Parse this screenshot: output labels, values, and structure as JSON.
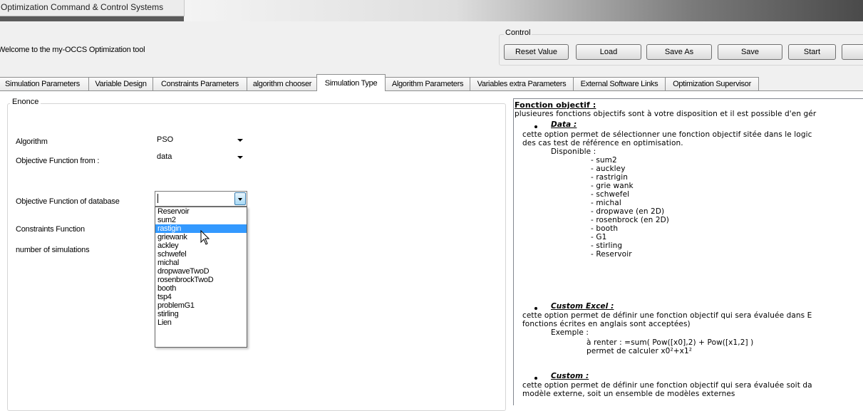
{
  "window": {
    "title": "Optimization Command & Control Systems"
  },
  "header": {
    "welcome": "Welcome to the my-OCCS Optimization tool",
    "control_label": "Control",
    "buttons": [
      "Reset Value",
      "Load",
      "Save As",
      "Save",
      "Start"
    ]
  },
  "tabs": [
    {
      "label": "Simulation Parameters",
      "active": false
    },
    {
      "label": "Variable Design",
      "active": false
    },
    {
      "label": "Constraints Parameters",
      "active": false
    },
    {
      "label": "algorithm chooser",
      "active": false
    },
    {
      "label": "Simulation Type",
      "active": true
    },
    {
      "label": "Algorithm Parameters",
      "active": false
    },
    {
      "label": "Variables extra Parameters",
      "active": false
    },
    {
      "label": "External Software Links",
      "active": false
    },
    {
      "label": "Optimization Supervisor",
      "active": false
    }
  ],
  "enonce": {
    "group_label": "Enonce",
    "algorithm_label": "Algorithm",
    "algorithm_value": "PSO",
    "objfrom_label": "Objective Function from :",
    "objfrom_value": "data",
    "objdb_label": "Objective Function of database",
    "objdb_value": "",
    "constraints_label": "Constraints Function",
    "nsim_label": "number of simulations"
  },
  "dropdown": {
    "items": [
      "Reservoir",
      "sum2",
      "rastigin",
      "griewank",
      "ackley",
      "schwefel",
      "michal",
      "dropwaveTwoD",
      "rosenbrockTwoD",
      "booth",
      "tsp4",
      "problemG1",
      "stirling",
      "Lien"
    ],
    "selected": "rastigin"
  },
  "help": {
    "heading": "Fonction objectif :",
    "intro": "plusieures fonctions objectifs sont à votre disposition et il est possible d'en gér",
    "data_title": "Data :",
    "data_l1": "cette option permet de sélectionner une fonction objectif sitée dans le logic",
    "data_l2": "des cas test de référence en optimisation.",
    "disponible": "Disponible :",
    "functions": [
      "- sum2",
      "- auckley",
      "- rastrigin",
      "- grie wank",
      "- schwefel",
      "- michal",
      "- dropwave (en 2D)",
      "- rosenbrock (en 2D)",
      "- booth",
      "- G1",
      "- stirling",
      "- Reservoir"
    ],
    "excel_title": "Custom Excel :",
    "excel_l1": "cette option permet de définir une fonction objectif qui sera évaluée dans E",
    "excel_l2": "fonctions écrites en anglais sont acceptées)",
    "exemple": "Exemple :",
    "exemple_l1": "à renter : =sum( Pow([x0],2) + Pow([x1,2] )",
    "exemple_l2": "permet de calculer x0²+x1²",
    "custom_title": "Custom :",
    "custom_l1": "cette option permet de définir une fonction objectif qui sera évaluée soit da",
    "custom_l2": "modèle externe, soit un ensemble de modèles externes"
  }
}
